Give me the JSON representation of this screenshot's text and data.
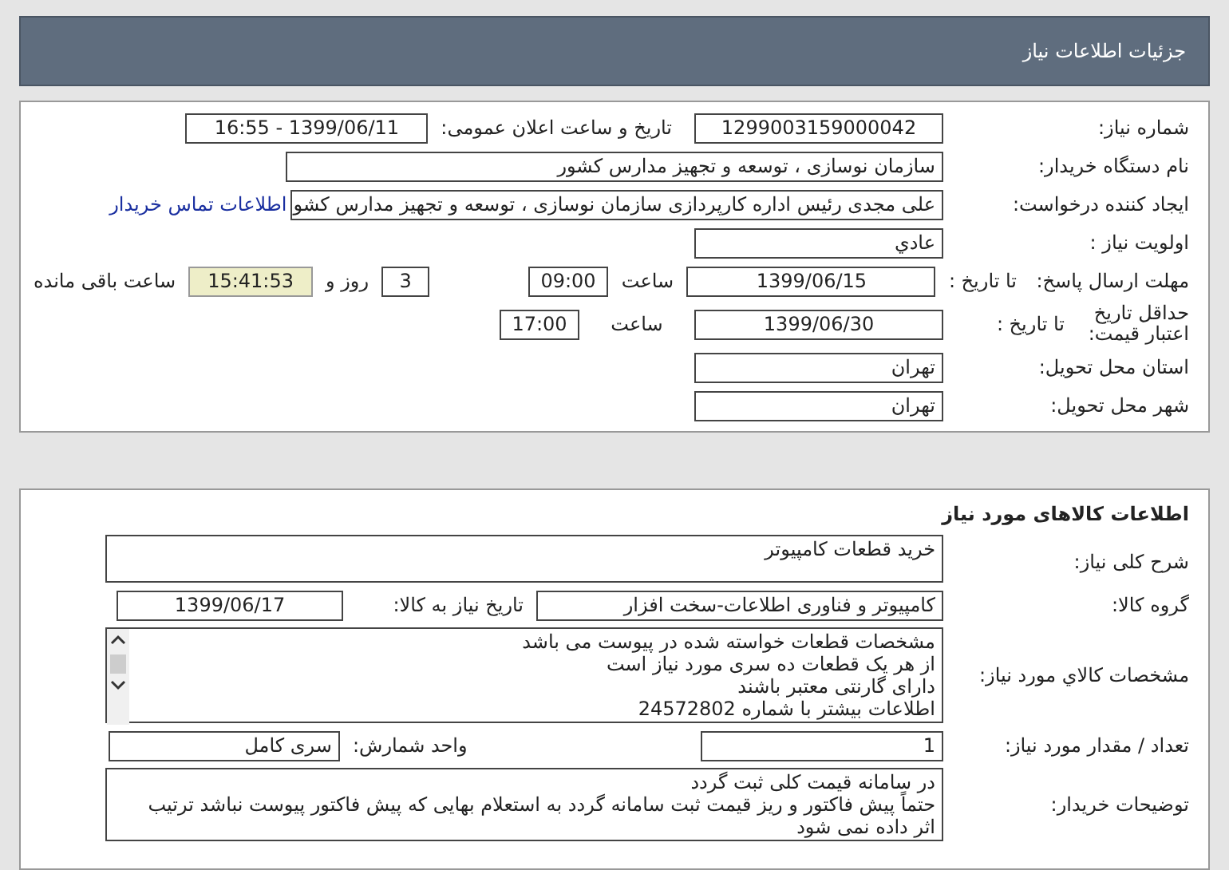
{
  "header": {
    "title": "جزئیات اطلاعات نیاز"
  },
  "details": {
    "need_number": {
      "label": "شماره نیاز:",
      "value": "1299003159000042"
    },
    "announce": {
      "label": "تاریخ و ساعت اعلان عمومی:",
      "value": "1399/06/11 - 16:55"
    },
    "buyer_org": {
      "label": "نام دستگاه خریدار:",
      "value": "سازمان نوسازی ، توسعه و تجهیز مدارس کشور"
    },
    "requester": {
      "label": "ایجاد کننده درخواست:",
      "value": "علی مجدی رئیس اداره کارپردازی سازمان نوسازی ، توسعه و تجهیز مدارس کشو",
      "link": "اطلاعات تماس خریدار"
    },
    "priority": {
      "label": "اولویت نیاز :",
      "value": "عادي"
    },
    "response_deadline": {
      "label": "مهلت ارسال پاسخ:",
      "date_label": "تا تاریخ :",
      "date": "1399/06/15",
      "time_label": "ساعت",
      "time": "09:00",
      "days": "3",
      "days_label": "روز و",
      "remaining": "15:41:53",
      "remaining_label": "ساعت باقی مانده"
    },
    "price_validity": {
      "label": "حداقل تاریخ اعتبار قیمت:",
      "date_label": "تا تاریخ :",
      "date": "1399/06/30",
      "time_label": "ساعت",
      "time": "17:00"
    },
    "province": {
      "label": "استان محل تحویل:",
      "value": "تهران"
    },
    "city": {
      "label": "شهر محل تحویل:",
      "value": "تهران"
    }
  },
  "goods": {
    "title": "اطلاعات کالاهای مورد نیاز",
    "summary": {
      "label": "شرح کلی نیاز:",
      "value": "خرید قطعات کامپیوتر"
    },
    "group": {
      "label": "گروه کالا:",
      "value": "کامپیوتر و فناوری اطلاعات-سخت افزار"
    },
    "need_date": {
      "label": "تاریخ نیاز به کالا:",
      "value": "1399/06/17"
    },
    "specs": {
      "label": "مشخصات کالاي مورد نیاز:",
      "lines": [
        "مشخصات قطعات خواسته شده در پیوست می باشد",
        "از هر یک قطعات ده سری مورد نیاز است",
        "دارای گارنتی معتبر باشند",
        "اطلاعات بیشتر با شماره 24572802"
      ]
    },
    "quantity": {
      "label": "تعداد / مقدار مورد نیاز:",
      "value": "1"
    },
    "unit": {
      "label": "واحد شمارش:",
      "value": "سری کامل"
    },
    "buyer_notes": {
      "label": "توضیحات خریدار:",
      "lines": [
        "در سامانه قیمت کلی ثبت گردد",
        "حتماً پیش فاکتور و ریز قیمت ثبت سامانه گردد به استعلام بهایی که پیش فاکتور پیوست نباشد ترتیب",
        "اثر داده نمی شود"
      ]
    }
  }
}
